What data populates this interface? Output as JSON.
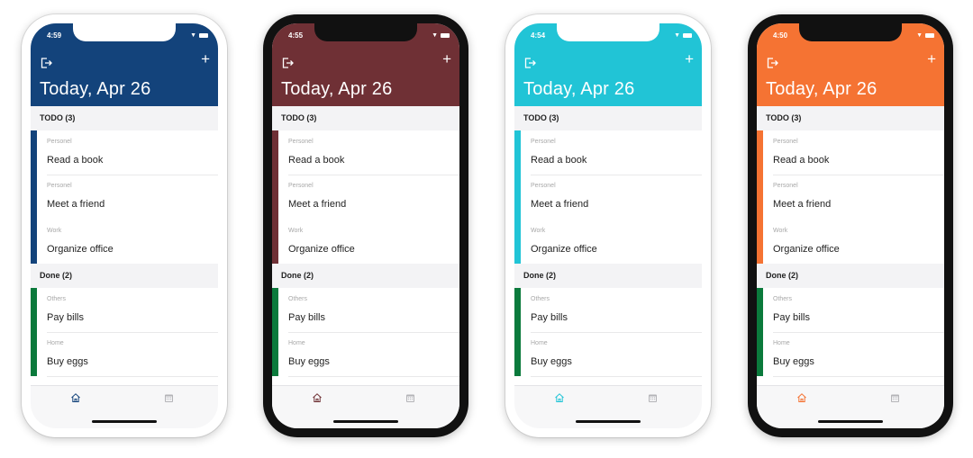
{
  "phones": [
    {
      "frame": "white",
      "time": "4:59",
      "theme": "#13437b"
    },
    {
      "frame": "black",
      "time": "4:55",
      "theme": "#6f3035"
    },
    {
      "frame": "white",
      "time": "4:54",
      "theme": "#21c4d6"
    },
    {
      "frame": "black",
      "time": "4:50",
      "theme": "#f57333"
    }
  ],
  "header": {
    "title": "Today,  Apr 26",
    "add_label": "+"
  },
  "todo_section": "TODO (3)",
  "done_section": "Done (2)",
  "todo_items": [
    {
      "category": "Personel",
      "name": "Read a book"
    },
    {
      "category": "Personel",
      "name": "Meet a friend"
    },
    {
      "category": "Work",
      "name": "Organize office"
    }
  ],
  "done_items": [
    {
      "category": "Others",
      "name": "Pay bills"
    },
    {
      "category": "Home",
      "name": "Buy eggs"
    }
  ],
  "done_color": "#0b7a3c",
  "tabs": [
    {
      "icon": "home-icon"
    },
    {
      "icon": "calendar-icon"
    }
  ]
}
